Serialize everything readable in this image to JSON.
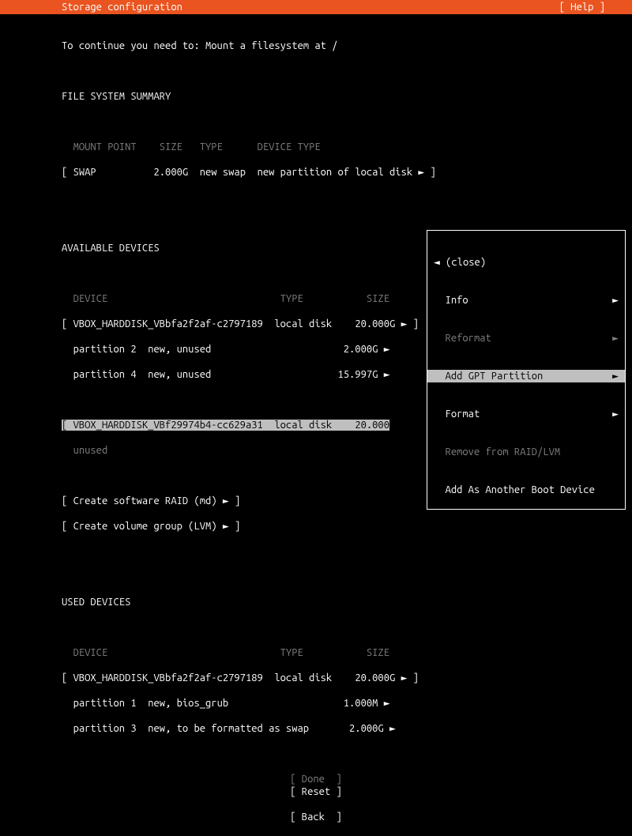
{
  "header": {
    "title": "Storage configuration",
    "help": "[ Help ]"
  },
  "instruction": "To continue you need to: Mount a filesystem at /",
  "section_fs": "FILE SYSTEM SUMMARY",
  "fs_header": {
    "mount": "MOUNT POINT",
    "size": "SIZE",
    "type": "TYPE",
    "dtype": "DEVICE TYPE"
  },
  "fs_rows": [
    {
      "mount": "SWAP",
      "size": "2.000G",
      "type": "new swap",
      "dtype": "new partition of local disk",
      "arrow": "►"
    }
  ],
  "section_av": "AVAILABLE DEVICES",
  "av_header": {
    "device": "DEVICE",
    "type": "TYPE",
    "size": "SIZE"
  },
  "av_dev1_name": "VBOX_HARDDISK_VBbfa2f2af-c2797189",
  "av_dev1_type": "local disk",
  "av_dev1_size": "20.000G",
  "av_dev1_p2": "partition 2  new, unused",
  "av_dev1_p2_size": "2.000G",
  "av_dev1_p4": "partition 4  new, unused",
  "av_dev1_p4_size": "15.997G",
  "av_dev2_name": "VBOX_HARDDISK_VBf29974b4-cc629a31",
  "av_dev2_type": "local disk",
  "av_dev2_size": "20.000",
  "av_dev2_state": "unused",
  "raid": "Create software RAID (md)",
  "lvm": "Create volume group (LVM)",
  "section_used": "USED DEVICES",
  "used_header": {
    "device": "DEVICE",
    "type": "TYPE",
    "size": "SIZE"
  },
  "used_dev_name": "VBOX_HARDDISK_VBbfa2f2af-c2797189",
  "used_dev_type": "local disk",
  "used_dev_size": "20.000G",
  "used_p1": "partition 1  new, bios_grub",
  "used_p1_size": "1.000M",
  "used_p3": "partition 3  new, to be formatted as swap",
  "used_p3_size": "2.000G",
  "buttons": {
    "done": "Done",
    "reset": "Reset",
    "back": "Back"
  },
  "popup": {
    "close": "(close)",
    "info": "Info",
    "reformat": "Reformat",
    "addgpt": "Add GPT Partition",
    "format": "Format",
    "remove": "Remove from RAID/LVM",
    "addboot": "Add As Another Boot Device"
  },
  "glyph": {
    "right": "►",
    "left": "◄"
  }
}
